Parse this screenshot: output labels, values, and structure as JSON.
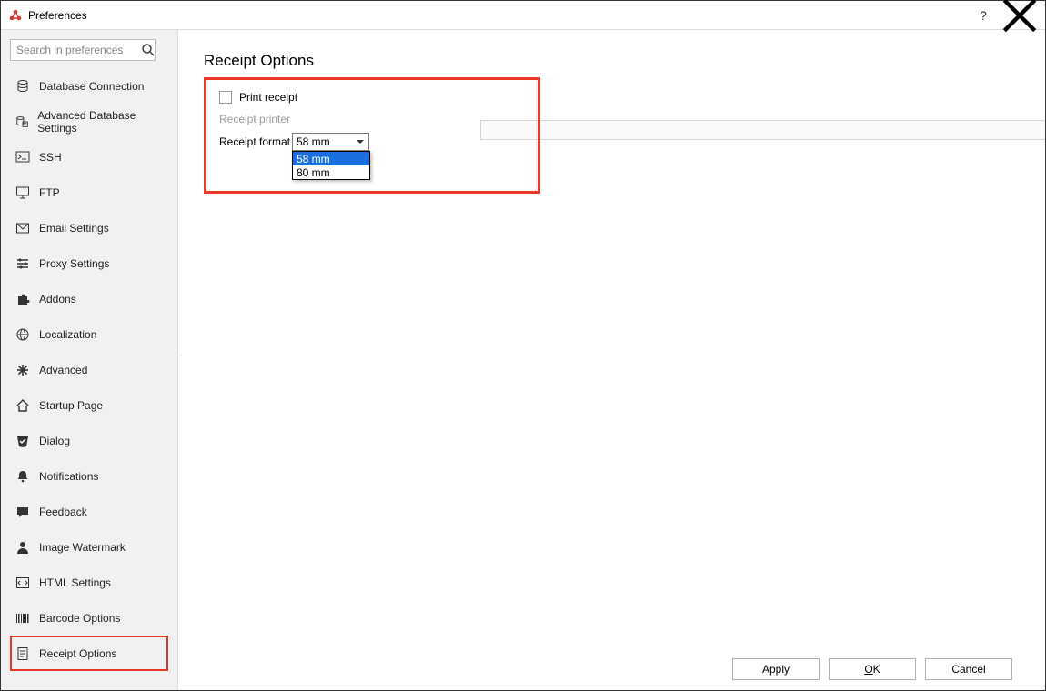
{
  "window": {
    "title": "Preferences",
    "help_tooltip": "?",
    "close_tooltip": "×"
  },
  "search": {
    "placeholder": "Search in preferences"
  },
  "sidebar": {
    "items": [
      {
        "icon": "database-icon",
        "label": "Database Connection"
      },
      {
        "icon": "db-advanced-icon",
        "label": "Advanced Database Settings"
      },
      {
        "icon": "terminal-icon",
        "label": "SSH"
      },
      {
        "icon": "monitor-icon",
        "label": "FTP"
      },
      {
        "icon": "mail-icon",
        "label": "Email Settings"
      },
      {
        "icon": "proxy-icon",
        "label": "Proxy Settings"
      },
      {
        "icon": "puzzle-icon",
        "label": "Addons"
      },
      {
        "icon": "globe-icon",
        "label": "Localization"
      },
      {
        "icon": "asterisk-icon",
        "label": "Advanced"
      },
      {
        "icon": "home-icon",
        "label": "Startup Page"
      },
      {
        "icon": "check-shield-icon",
        "label": "Dialog"
      },
      {
        "icon": "bell-icon",
        "label": "Notifications"
      },
      {
        "icon": "chat-icon",
        "label": "Feedback"
      },
      {
        "icon": "person-icon",
        "label": "Image Watermark"
      },
      {
        "icon": "code-icon",
        "label": "HTML Settings"
      },
      {
        "icon": "barcode-icon",
        "label": "Barcode Options"
      },
      {
        "icon": "receipt-icon",
        "label": "Receipt Options"
      }
    ],
    "selected_index": 16
  },
  "page": {
    "title": "Receipt Options",
    "print_receipt_label": "Print receipt",
    "print_receipt_checked": false,
    "receipt_printer_label": "Receipt printer",
    "receipt_printer_value": "",
    "receipt_format_label": "Receipt format",
    "receipt_format_selected": "58 mm",
    "receipt_format_options": [
      "58 mm",
      "80 mm"
    ]
  },
  "footer": {
    "apply": "Apply",
    "ok_full": "OK",
    "cancel": "Cancel"
  }
}
